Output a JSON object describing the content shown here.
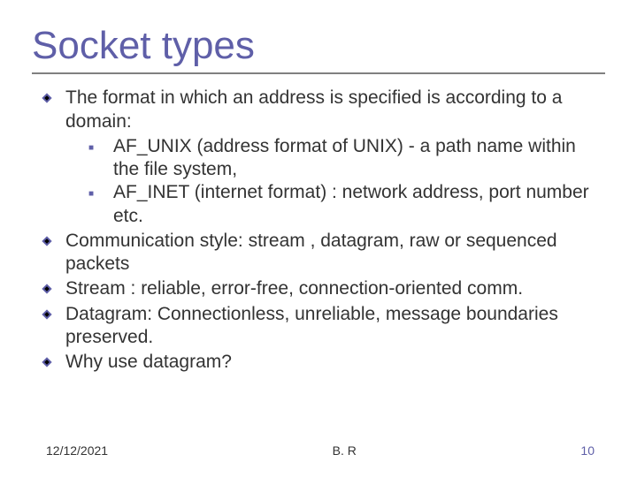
{
  "title": "Socket types",
  "bullets": [
    {
      "text": "The format in which an address is specified is according to  a domain:",
      "subs": [
        " AF_UNIX (address format of UNIX) - a path name within the file system,",
        "AF_INET (internet format) : network address, port number etc."
      ]
    },
    {
      "text": "Communication style: stream , datagram, raw or sequenced packets"
    },
    {
      "text": "Stream : reliable, error-free, connection-oriented comm."
    },
    {
      "text": "Datagram: Connectionless, unreliable, message boundaries preserved."
    },
    {
      "text": "Why use datagram?"
    }
  ],
  "footer": {
    "date": "12/12/2021",
    "author": "B. R",
    "slide": "10"
  }
}
